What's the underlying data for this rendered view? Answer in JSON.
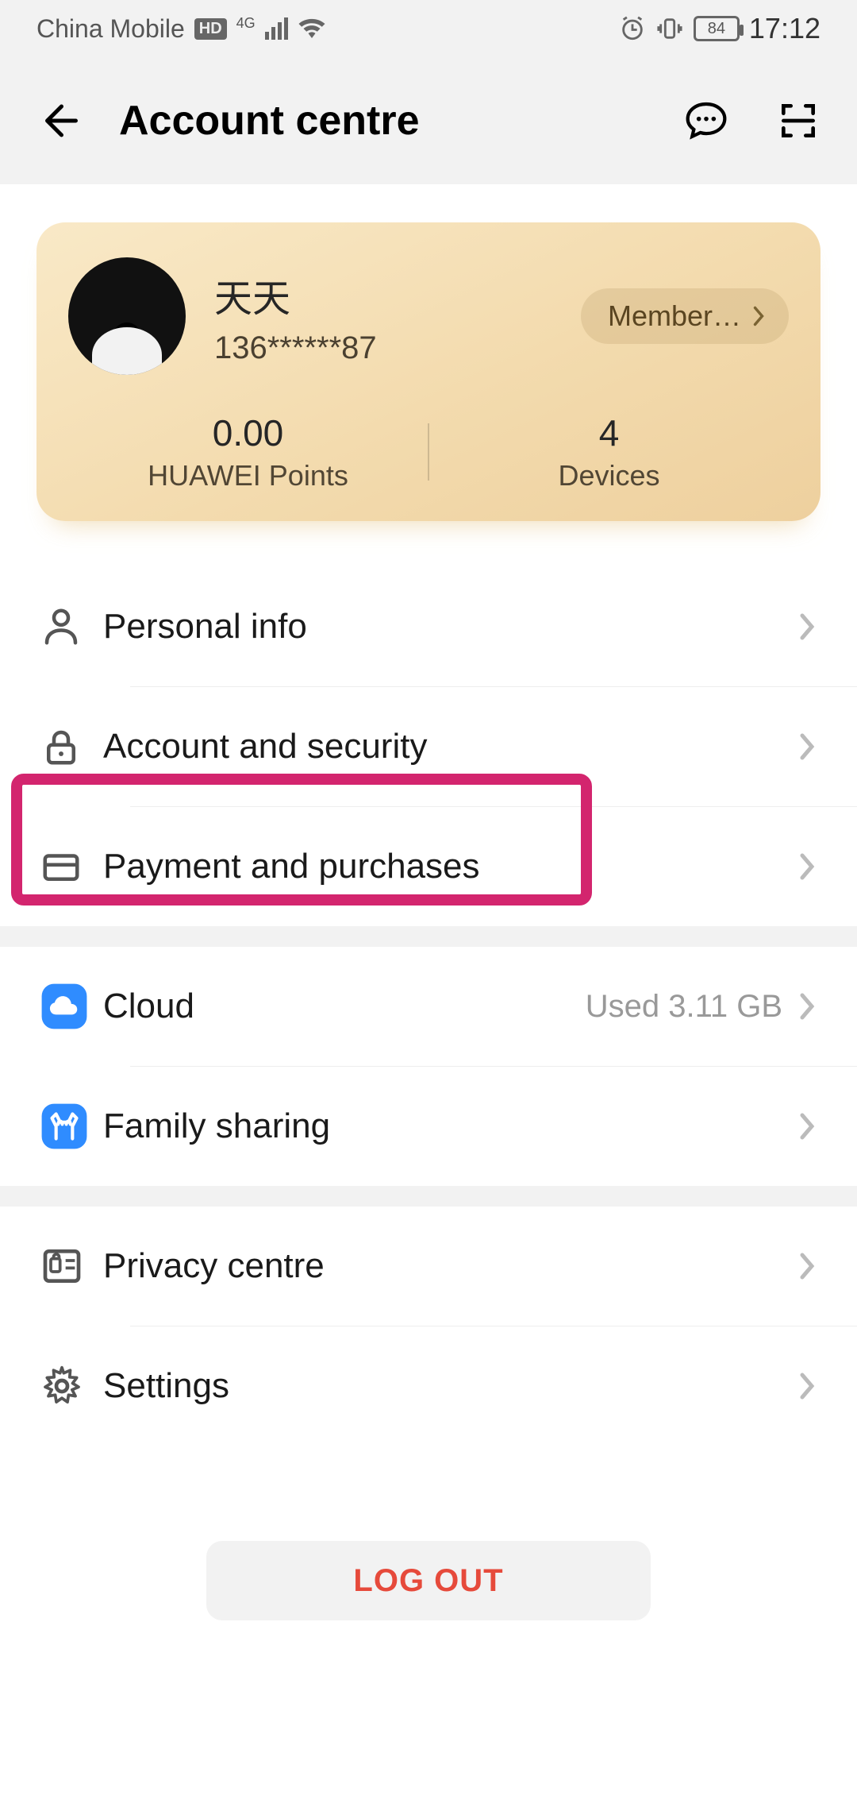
{
  "statusbar": {
    "carrier": "China Mobile",
    "net_label": "4G",
    "battery": "84",
    "time": "17:12"
  },
  "header": {
    "title": "Account centre"
  },
  "card": {
    "username": "天天",
    "phone": "136******87",
    "member_label": "Member…",
    "points_value": "0.00",
    "points_label": "HUAWEI Points",
    "devices_value": "4",
    "devices_label": "Devices"
  },
  "menu": {
    "personal_info": "Personal info",
    "account_security": "Account and security",
    "payment": "Payment and purchases",
    "cloud": "Cloud",
    "cloud_extra": "Used 3.11 GB",
    "family": "Family sharing",
    "privacy": "Privacy centre",
    "settings": "Settings"
  },
  "logout": "LOG OUT"
}
